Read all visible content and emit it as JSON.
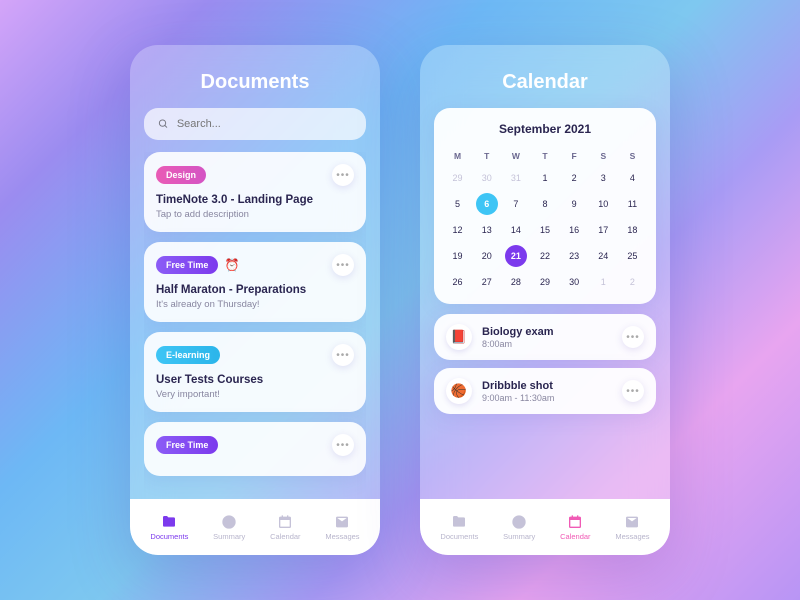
{
  "documents": {
    "title": "Documents",
    "search_placeholder": "Search...",
    "cards": [
      {
        "tag": "Design",
        "tag_color": "pink",
        "emoji": "",
        "title": "TimeNote 3.0 - Landing Page",
        "desc": "Tap to add description"
      },
      {
        "tag": "Free Time",
        "tag_color": "purple",
        "emoji": "⏰",
        "title": "Half Maraton - Preparations",
        "desc": "It's already on Thursday!"
      },
      {
        "tag": "E-learning",
        "tag_color": "blue",
        "emoji": "",
        "title": "User Tests Courses",
        "desc": "Very important!"
      },
      {
        "tag": "Free Time",
        "tag_color": "purple",
        "emoji": "",
        "title": "",
        "desc": ""
      }
    ]
  },
  "calendar": {
    "title": "Calendar",
    "month_label": "September 2021",
    "dow": [
      "M",
      "T",
      "W",
      "T",
      "F",
      "S",
      "S"
    ],
    "days": [
      {
        "n": 29,
        "muted": true
      },
      {
        "n": 30,
        "muted": true
      },
      {
        "n": 31,
        "muted": true
      },
      {
        "n": 1
      },
      {
        "n": 2
      },
      {
        "n": 3
      },
      {
        "n": 4
      },
      {
        "n": 5
      },
      {
        "n": 6,
        "today": true
      },
      {
        "n": 7
      },
      {
        "n": 8
      },
      {
        "n": 9
      },
      {
        "n": 10
      },
      {
        "n": 11
      },
      {
        "n": 12
      },
      {
        "n": 13
      },
      {
        "n": 14
      },
      {
        "n": 15
      },
      {
        "n": 16
      },
      {
        "n": 17
      },
      {
        "n": 18
      },
      {
        "n": 19
      },
      {
        "n": 20
      },
      {
        "n": 21,
        "selected": true
      },
      {
        "n": 22
      },
      {
        "n": 23
      },
      {
        "n": 24
      },
      {
        "n": 25
      },
      {
        "n": 26
      },
      {
        "n": 27
      },
      {
        "n": 28
      },
      {
        "n": 29
      },
      {
        "n": 30
      },
      {
        "n": 1,
        "muted": true
      },
      {
        "n": 2,
        "muted": true
      }
    ],
    "events": [
      {
        "emoji": "📕",
        "title": "Biology exam",
        "time": "8:00am"
      },
      {
        "emoji": "🏀",
        "title": "Dribbble shot",
        "time": "9:00am - 11:30am"
      }
    ]
  },
  "tabs": [
    {
      "id": "documents",
      "label": "Documents"
    },
    {
      "id": "summary",
      "label": "Summary"
    },
    {
      "id": "calendar",
      "label": "Calendar"
    },
    {
      "id": "messages",
      "label": "Messages"
    }
  ]
}
